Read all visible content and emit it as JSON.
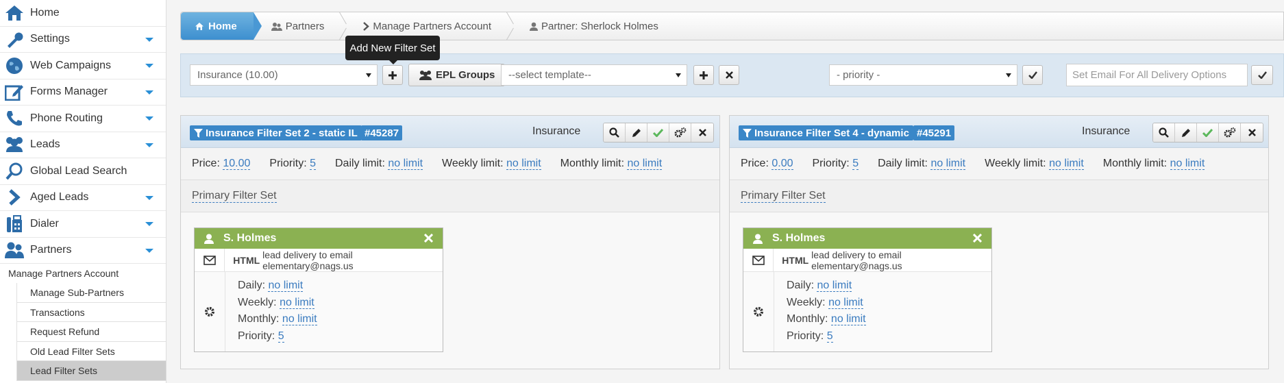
{
  "sidebar": {
    "items": [
      {
        "label": "Home",
        "icon": "home-icon",
        "caret": false
      },
      {
        "label": "Settings",
        "icon": "wrench-icon",
        "caret": true
      },
      {
        "label": "Web Campaigns",
        "icon": "globe-icon",
        "caret": true
      },
      {
        "label": "Forms Manager",
        "icon": "edit-icon",
        "caret": true
      },
      {
        "label": "Phone Routing",
        "icon": "phone-icon",
        "caret": true
      },
      {
        "label": "Leads",
        "icon": "users-icon",
        "caret": true
      },
      {
        "label": "Global Lead Search",
        "icon": "search-icon",
        "caret": false
      },
      {
        "label": "Aged Leads",
        "icon": "chevron-right-icon",
        "caret": true
      },
      {
        "label": "Dialer",
        "icon": "fax-icon",
        "caret": true
      },
      {
        "label": "Partners",
        "icon": "partners-icon",
        "caret": true
      }
    ],
    "submenu_title": "Manage Partners Account",
    "submenu": [
      "Manage Sub-Partners",
      "Transactions",
      "Request Refund",
      "Old Lead Filter Sets",
      "Lead Filter Sets"
    ]
  },
  "breadcrumb": {
    "home": "Home",
    "partners": "Partners",
    "manage": "Manage Partners Account",
    "partner": "Partner: Sherlock Holmes"
  },
  "toolbar": {
    "insurance_select": "Insurance (10.00)",
    "add_label": "+",
    "tooltip": "Add New Filter Set",
    "epl_groups": "EPL Groups",
    "template_select": "--select template--",
    "priority_select": "- priority -",
    "email_placeholder": "Set Email For All Delivery Options"
  },
  "panels": [
    {
      "title": "Insurance Filter Set 2 - static IL",
      "id": "#45287",
      "category": "Insurance",
      "price_label": "Price:",
      "price": "10.00",
      "priority_label": "Priority:",
      "priority": "5",
      "daily_label": "Daily limit:",
      "daily": "no limit",
      "weekly_label": "Weekly limit:",
      "weekly": "no limit",
      "monthly_label": "Monthly limit:",
      "monthly": "no limit",
      "primary": "Primary Filter Set",
      "card": {
        "name": "S. Holmes",
        "format": "HTML",
        "delivery": "lead delivery to email elementary@nags.us",
        "daily_label": "Daily:",
        "daily": "no limit",
        "weekly_label": "Weekly:",
        "weekly": "no limit",
        "monthly_label": "Monthly:",
        "monthly": "no limit",
        "priority_label": "Priority:",
        "priority": "5"
      }
    },
    {
      "title": "Insurance Filter Set 4 - dynamic",
      "id": "#45291",
      "category": "Insurance",
      "price_label": "Price:",
      "price": "0.00",
      "priority_label": "Priority:",
      "priority": "5",
      "daily_label": "Daily limit:",
      "daily": "no limit",
      "weekly_label": "Weekly limit:",
      "weekly": "no limit",
      "monthly_label": "Monthly limit:",
      "monthly": "no limit",
      "primary": "Primary Filter Set",
      "card": {
        "name": "S. Holmes",
        "format": "HTML",
        "delivery": "lead delivery to email elementary@nags.us",
        "daily_label": "Daily:",
        "daily": "no limit",
        "weekly_label": "Weekly:",
        "weekly": "no limit",
        "monthly_label": "Monthly:",
        "monthly": "no limit",
        "priority_label": "Priority:",
        "priority": "5"
      }
    }
  ],
  "colors": {
    "accent": "#3a87c8",
    "card_header": "#8bb152",
    "caret": "#2a8fd6"
  }
}
